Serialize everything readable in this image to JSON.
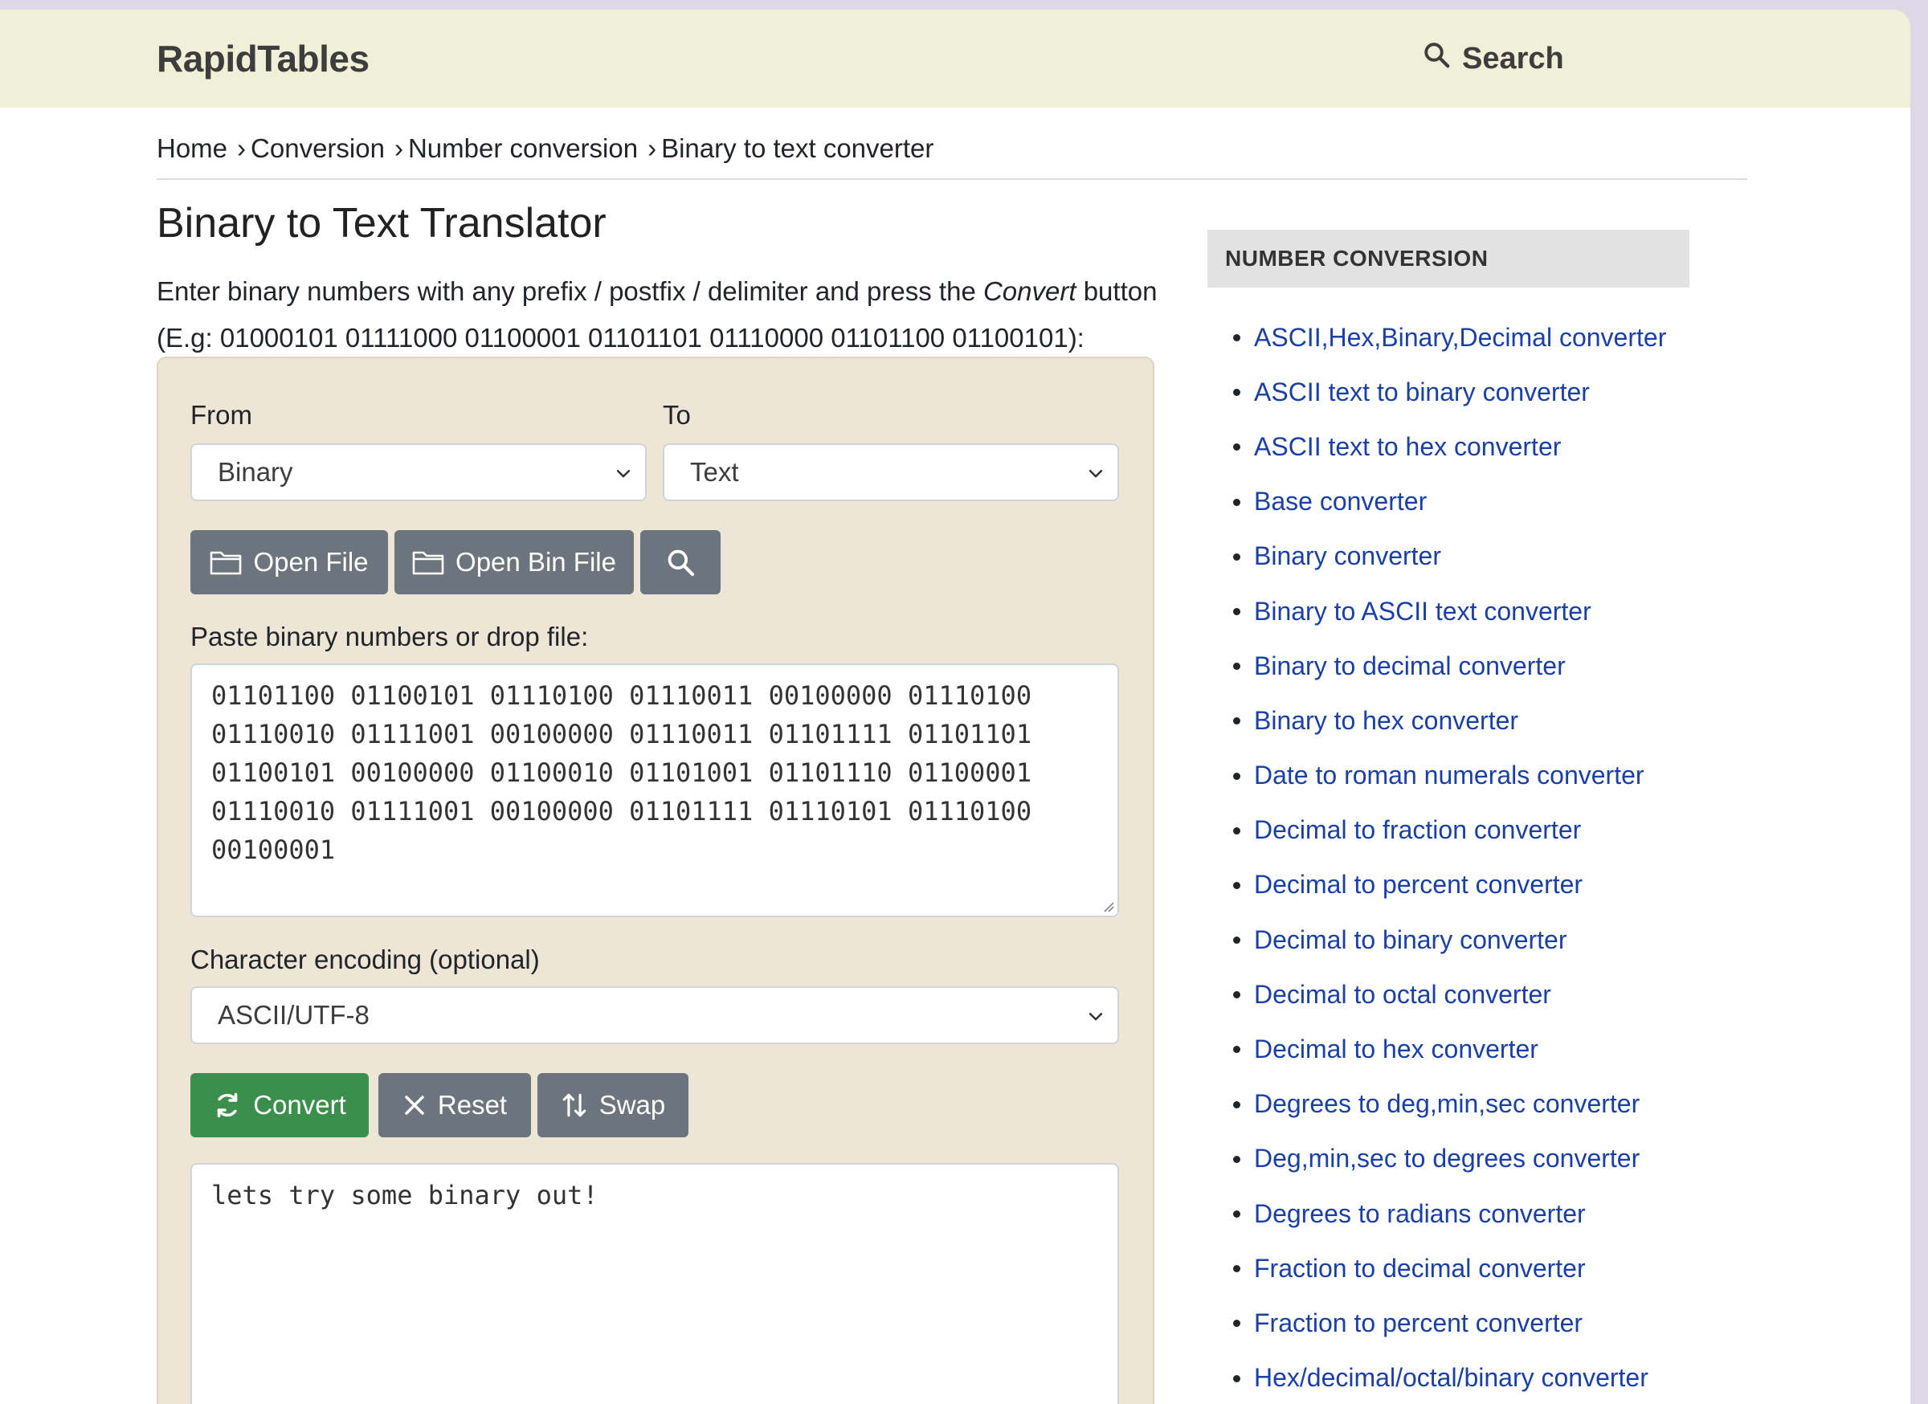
{
  "header": {
    "logo": "RapidTables",
    "search_label": "Search"
  },
  "breadcrumb": [
    {
      "label": "Home"
    },
    {
      "label": "Conversion"
    },
    {
      "label": "Number conversion"
    },
    {
      "label": "Binary to text converter"
    }
  ],
  "page": {
    "title": "Binary to Text Translator",
    "intro_line1_before": "Enter binary numbers with any prefix / postfix / delimiter and press the ",
    "intro_line1_em": "Convert",
    "intro_line1_after": " button",
    "intro_line2": "(E.g: 01000101 01111000 01100001 01101101 01110000 01101100 01100101):"
  },
  "form": {
    "from_label": "From",
    "from_value": "Binary",
    "to_label": "To",
    "to_value": "Text",
    "open_file_label": "Open File",
    "open_bin_file_label": "Open Bin File",
    "input_label": "Paste binary numbers or drop file:",
    "input_value": "01101100 01100101 01110100 01110011 00100000 01110100\n01110010 01111001 00100000 01110011 01101111 01101101\n01100101 00100000 01100010 01101001 01101110 01100001\n01110010 01111001 00100000 01101111 01110101 01110100\n00100001",
    "encoding_label": "Character encoding (optional)",
    "encoding_value": "ASCII/UTF-8",
    "convert_label": "Convert",
    "reset_label": "Reset",
    "swap_label": "Swap",
    "output_value": "lets try some binary out!"
  },
  "sidebar": {
    "heading": "NUMBER CONVERSION",
    "items": [
      "ASCII,Hex,Binary,Decimal converter",
      "ASCII text to binary converter",
      "ASCII text to hex converter",
      "Base converter",
      "Binary converter",
      "Binary to ASCII text converter",
      "Binary to decimal converter",
      "Binary to hex converter",
      "Date to roman numerals converter",
      "Decimal to fraction converter",
      "Decimal to percent converter",
      "Decimal to binary converter",
      "Decimal to octal converter",
      "Decimal to hex converter",
      "Degrees to deg,min,sec converter",
      "Deg,min,sec to degrees converter",
      "Degrees to radians converter",
      "Fraction to decimal converter",
      "Fraction to percent converter",
      "Hex/decimal/octal/binary converter"
    ]
  },
  "colors": {
    "topbar": "#f0f0d8",
    "panel": "#ede6d6",
    "button_gray": "#6c757d",
    "button_green": "#3a8f4a",
    "link": "#1a3fa6"
  }
}
